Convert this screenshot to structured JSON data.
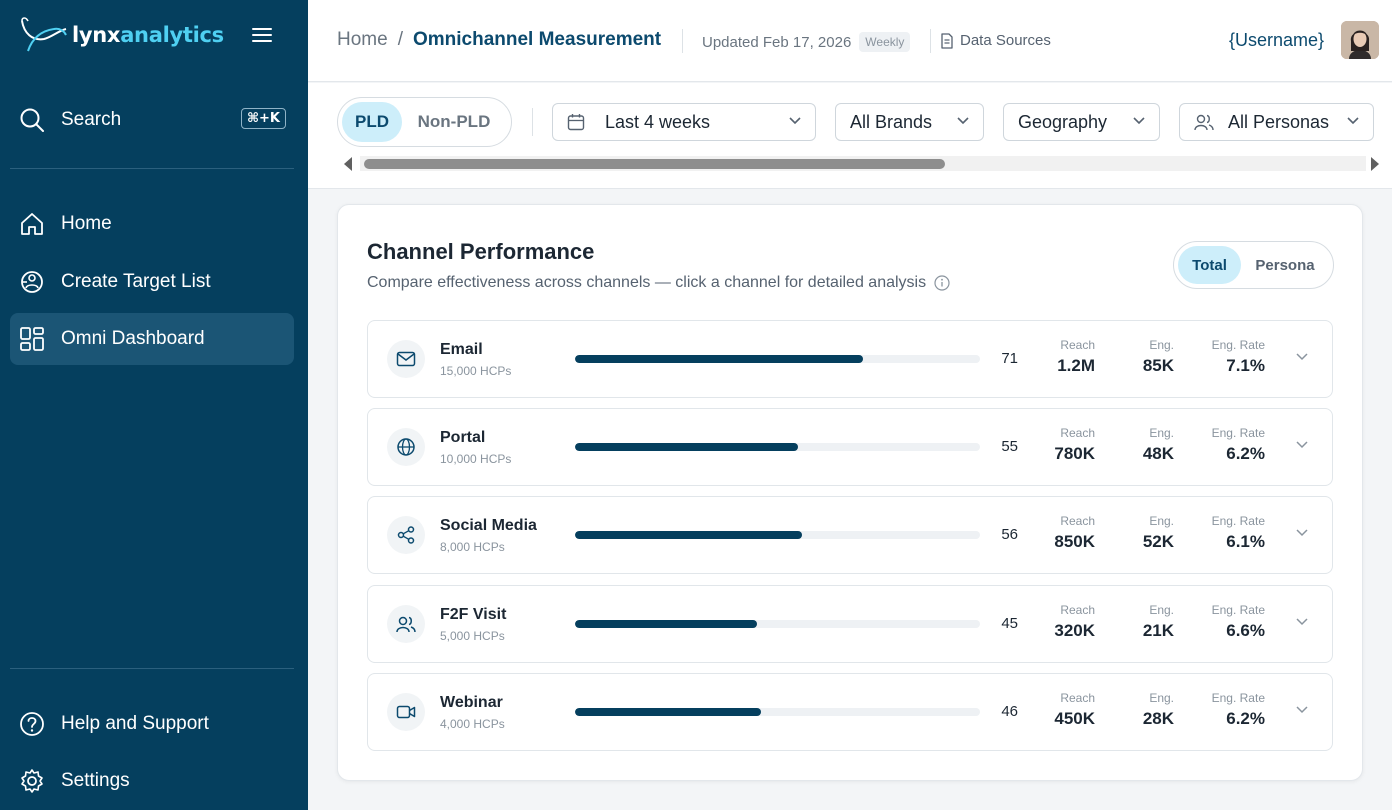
{
  "sidebar": {
    "logo_part1": "lynx",
    "logo_part2": "analytics",
    "search_label": "Search",
    "search_shortcut": "⌘+K",
    "nav": [
      {
        "label": "Home",
        "icon": "home-icon"
      },
      {
        "label": "Create Target List",
        "icon": "target-list-icon"
      },
      {
        "label": "Omni Dashboard",
        "icon": "dashboard-icon",
        "active": true
      }
    ],
    "bottom": [
      {
        "label": "Help and Support",
        "icon": "help-icon"
      },
      {
        "label": "Settings",
        "icon": "gear-icon"
      }
    ]
  },
  "header": {
    "breadcrumb_home": "Home",
    "breadcrumb_sep": "/",
    "breadcrumb_current": "Omnichannel Measurement",
    "updated": "Updated Feb 17, 2026",
    "frequency_badge": "Weekly",
    "data_sources": "Data Sources",
    "username": "{Username}"
  },
  "filters": {
    "segment": {
      "on": "PLD",
      "off": "Non-PLD"
    },
    "date_range": "Last 4 weeks",
    "brands": "All Brands",
    "geography": "Geography",
    "personas": "All Personas"
  },
  "card": {
    "title": "Channel Performance",
    "subtitle": "Compare effectiveness across channels — click a channel for detailed analysis",
    "toggle": {
      "on": "Total",
      "off": "Persona"
    },
    "metric_labels": {
      "reach": "Reach",
      "eng": "Eng.",
      "rate": "Eng. Rate"
    },
    "channels": [
      {
        "name": "Email",
        "hcps": "15,000 HCPs",
        "score": 71,
        "reach": "1.2M",
        "eng": "85K",
        "rate": "7.1%",
        "icon": "mail-icon"
      },
      {
        "name": "Portal",
        "hcps": "10,000 HCPs",
        "score": 55,
        "reach": "780K",
        "eng": "48K",
        "rate": "6.2%",
        "icon": "globe-icon"
      },
      {
        "name": "Social Media",
        "hcps": "8,000 HCPs",
        "score": 56,
        "reach": "850K",
        "eng": "52K",
        "rate": "6.1%",
        "icon": "share-icon"
      },
      {
        "name": "F2F Visit",
        "hcps": "5,000 HCPs",
        "score": 45,
        "reach": "320K",
        "eng": "21K",
        "rate": "6.6%",
        "icon": "users-icon"
      },
      {
        "name": "Webinar",
        "hcps": "4,000 HCPs",
        "score": 46,
        "reach": "450K",
        "eng": "28K",
        "rate": "6.2%",
        "icon": "video-icon"
      }
    ]
  },
  "colors": {
    "sidebar": "#053f5e",
    "accent": "#0c4a6e",
    "logo_accent": "#4fd0f2",
    "active_pill": "#cdeefa"
  }
}
